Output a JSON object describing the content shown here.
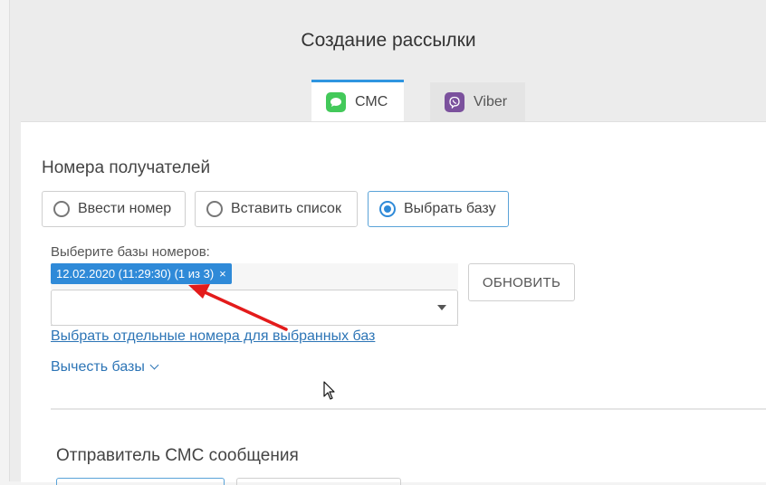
{
  "page": {
    "title": "Создание рассылки"
  },
  "tabs": [
    {
      "label": "СМС",
      "icon": "sms-chat-icon",
      "active": true
    },
    {
      "label": "Viber",
      "icon": "viber-icon",
      "active": false
    }
  ],
  "recipients": {
    "title": "Номера получателей",
    "options": [
      {
        "label": "Ввести номер",
        "selected": false
      },
      {
        "label": "Вставить список",
        "selected": false
      },
      {
        "label": "Выбрать базу",
        "selected": true
      }
    ],
    "bases_label": "Выберите базы номеров:",
    "selected_tag": "12.02.2020 (11:29:30) (1 из 3)",
    "tag_remove": "×",
    "refresh_button": "ОБНОВИТЬ",
    "select_numbers_link": "Выбрать отдельные номера для выбранных баз",
    "subtract_bases_link": "Вычесть базы"
  },
  "sender": {
    "title": "Отправитель СМС сообщения"
  },
  "colors": {
    "accent": "#2f8ad8",
    "link": "#2d75b6",
    "annotation_arrow": "#e31b1b"
  }
}
